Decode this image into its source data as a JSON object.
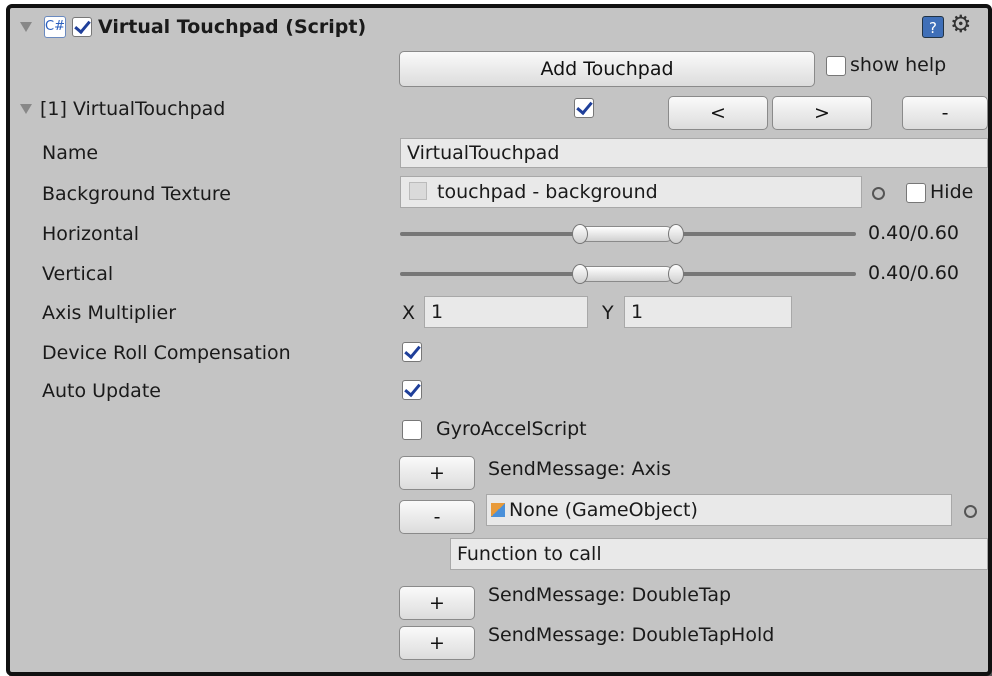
{
  "header": {
    "title": "Virtual Touchpad (Script)",
    "enabled": true
  },
  "toolbar": {
    "add_label": "Add Touchpad",
    "show_help_label": "show help",
    "show_help_checked": false
  },
  "item": {
    "title": "[1] VirtualTouchpad",
    "enabled": true,
    "prev_label": "<",
    "next_label": ">",
    "remove_label": "-"
  },
  "fields": {
    "name_label": "Name",
    "name_value": "VirtualTouchpad",
    "bg_label": "Background Texture",
    "bg_value": "touchpad - background",
    "hide_label": "Hide",
    "horizontal_label": "Horizontal",
    "horizontal_value": "0.40/0.60",
    "vertical_label": "Vertical",
    "vertical_value": "0.40/0.60",
    "axis_label": "Axis Multiplier",
    "x_label": "X",
    "x_value": "1",
    "y_label": "Y",
    "y_value": "1",
    "roll_label": "Device Roll Compensation",
    "roll_checked": true,
    "auto_label": "Auto Update",
    "auto_checked": true,
    "gyro_label": "GyroAccelScript",
    "gyro_checked": false
  },
  "messages": {
    "plus": "+",
    "minus": "-",
    "axis_label": "SendMessage: Axis",
    "gameobject_value": "None (GameObject)",
    "function_value": "Function to call",
    "doubletap_label": "SendMessage: DoubleTap",
    "doubletaphold_label": "SendMessage: DoubleTapHold"
  },
  "colors": {
    "panel_bg": "#c4c4c4",
    "check_blue": "#1f3f9a"
  }
}
